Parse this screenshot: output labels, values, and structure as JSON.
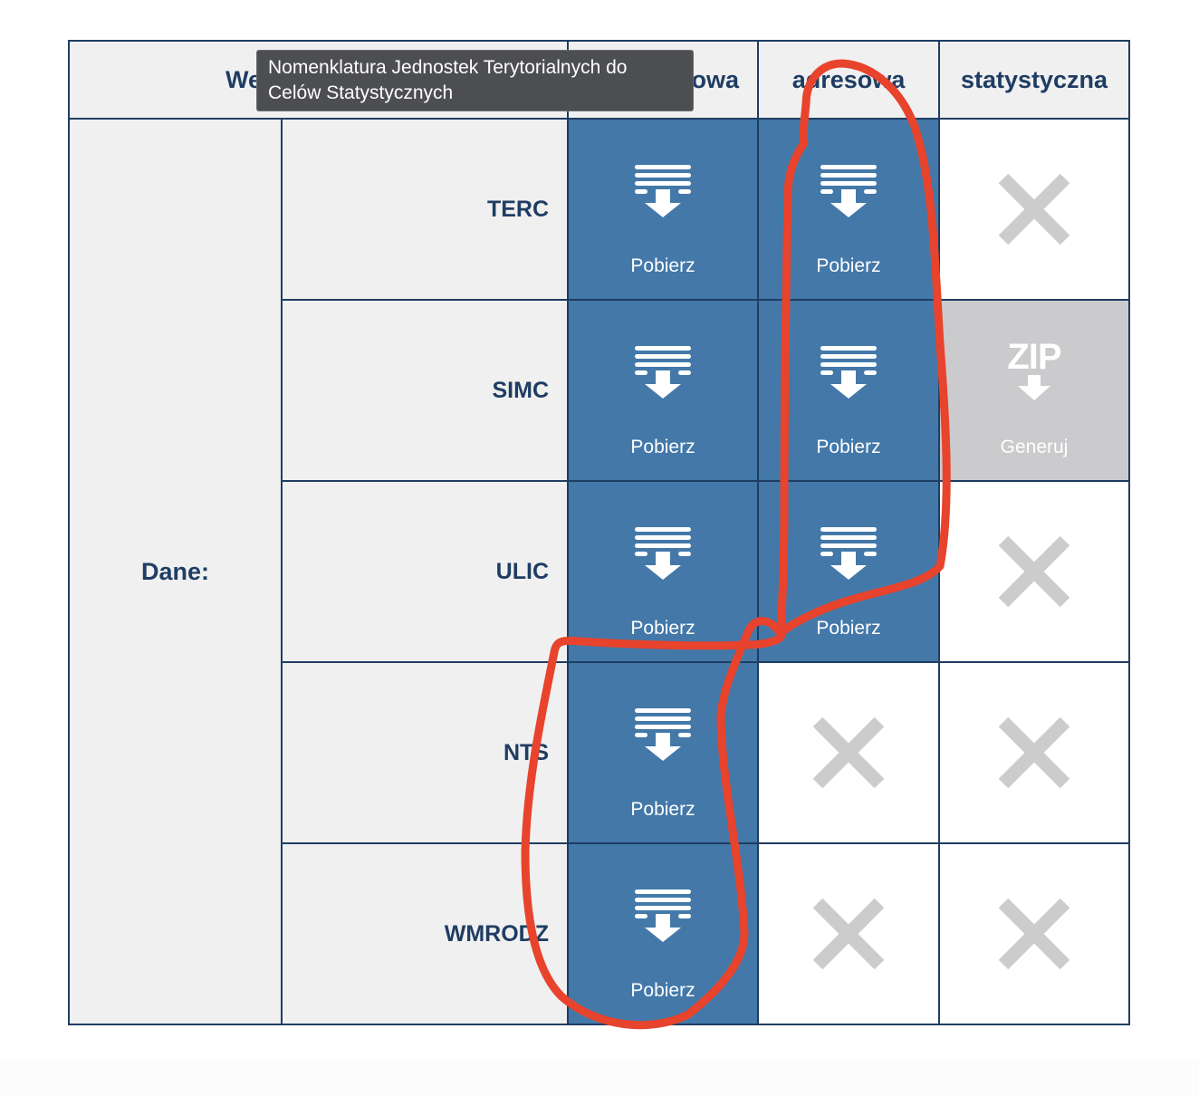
{
  "header": {
    "col_wersja_partial": "We",
    "col_podstawowa_partial": "owa",
    "col_adresowa": "adresowa",
    "col_statystyczna": "statystyczna"
  },
  "tooltip": {
    "text": "Nomenklatura Jednostek Terytorialnych do Celów Statystycznych"
  },
  "section_label": "Dane:",
  "rows": [
    {
      "label": "TERC"
    },
    {
      "label": "SIMC"
    },
    {
      "label": "ULIC"
    },
    {
      "label": "NTS"
    },
    {
      "label": "WMRODZ"
    }
  ],
  "actions": {
    "download_label": "Pobierz",
    "generate_label": "Generuj",
    "zip_text": "ZIP"
  },
  "colors": {
    "border": "#1f3d63",
    "header_bg": "#f0f0f0",
    "button_blue": "#4378a9",
    "button_grey": "#cbcbcd",
    "unavailable_x": "#cccccc",
    "annotation_red": "#e8432c"
  },
  "icons": {
    "download": "download-list-icon",
    "unavailable": "x-icon",
    "zip": "zip-download-icon"
  }
}
